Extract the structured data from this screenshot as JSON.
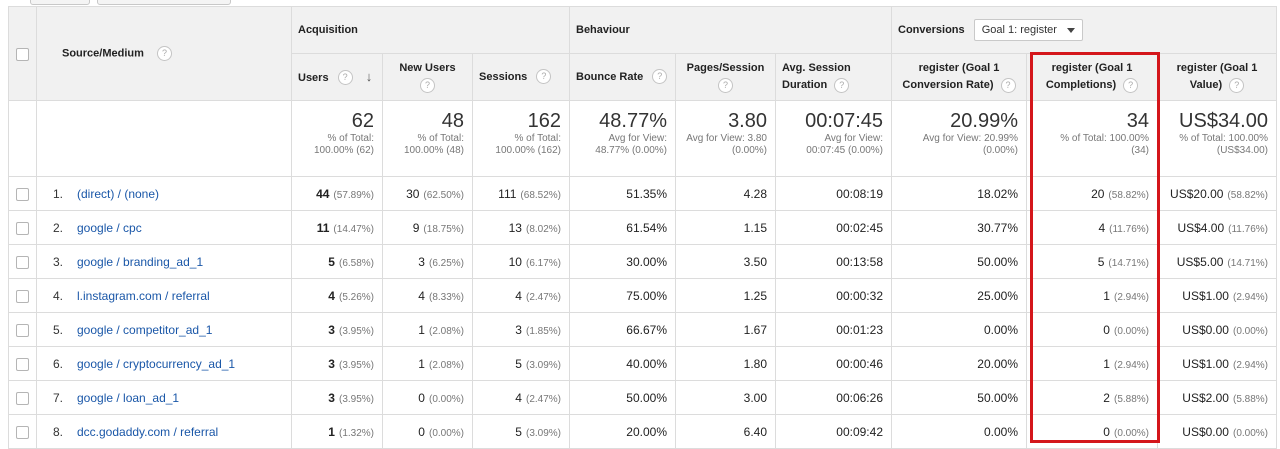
{
  "header": {
    "source_medium": "Source/Medium",
    "acquisition": "Acquisition",
    "behaviour": "Behaviour",
    "conversions": "Conversions",
    "goal_select": "Goal 1: register",
    "columns": {
      "users": "Users",
      "new_users": "New Users",
      "sessions": "Sessions",
      "bounce_rate": "Bounce Rate",
      "pages_session": "Pages/Session",
      "avg_session_l1": "Avg. Session",
      "avg_session_l2": "Duration",
      "conv_rate_l1": "register (Goal 1",
      "conv_rate_l2": "Conversion Rate)",
      "completions_l1": "register (Goal 1",
      "completions_l2": "Completions)",
      "value_l1": "register (Goal 1",
      "value_l2": "Value)"
    },
    "help_glyph": "?",
    "sort_glyph": "↓"
  },
  "totals": {
    "users": {
      "big": "62",
      "s1": "% of Total:",
      "s2": "100.00% (62)"
    },
    "new_users": {
      "big": "48",
      "s1": "% of Total:",
      "s2": "100.00% (48)"
    },
    "sessions": {
      "big": "162",
      "s1": "% of Total:",
      "s2": "100.00% (162)"
    },
    "bounce_rate": {
      "big": "48.77%",
      "s1": "Avg for View:",
      "s2": "48.77% (0.00%)"
    },
    "pages_session": {
      "big": "3.80",
      "s1": "Avg for View: 3.80",
      "s2": "(0.00%)"
    },
    "avg_session": {
      "big": "00:07:45",
      "s1": "Avg for View:",
      "s2": "00:07:45 (0.00%)"
    },
    "conv_rate": {
      "big": "20.99%",
      "s1": "Avg for View: 20.99%",
      "s2": "(0.00%)"
    },
    "completions": {
      "big": "34",
      "s1": "% of Total: 100.00%",
      "s2": "(34)"
    },
    "value": {
      "big": "US$34.00",
      "s1": "% of Total: 100.00%",
      "s2": "(US$34.00)"
    }
  },
  "rows": [
    {
      "n": "1.",
      "src": "(direct) / (none)",
      "users": "44",
      "users_p": "(57.89%)",
      "new": "30",
      "new_p": "(62.50%)",
      "sess": "111",
      "sess_p": "(68.52%)",
      "br": "51.35%",
      "ps": "4.28",
      "dur": "00:08:19",
      "cr": "18.02%",
      "comp": "20",
      "comp_p": "(58.82%)",
      "val": "US$20.00",
      "val_p": "(58.82%)"
    },
    {
      "n": "2.",
      "src": "google / cpc",
      "users": "11",
      "users_p": "(14.47%)",
      "new": "9",
      "new_p": "(18.75%)",
      "sess": "13",
      "sess_p": "(8.02%)",
      "br": "61.54%",
      "ps": "1.15",
      "dur": "00:02:45",
      "cr": "30.77%",
      "comp": "4",
      "comp_p": "(11.76%)",
      "val": "US$4.00",
      "val_p": "(11.76%)"
    },
    {
      "n": "3.",
      "src": "google / branding_ad_1",
      "users": "5",
      "users_p": "(6.58%)",
      "new": "3",
      "new_p": "(6.25%)",
      "sess": "10",
      "sess_p": "(6.17%)",
      "br": "30.00%",
      "ps": "3.50",
      "dur": "00:13:58",
      "cr": "50.00%",
      "comp": "5",
      "comp_p": "(14.71%)",
      "val": "US$5.00",
      "val_p": "(14.71%)"
    },
    {
      "n": "4.",
      "src": "l.instagram.com / referral",
      "users": "4",
      "users_p": "(5.26%)",
      "new": "4",
      "new_p": "(8.33%)",
      "sess": "4",
      "sess_p": "(2.47%)",
      "br": "75.00%",
      "ps": "1.25",
      "dur": "00:00:32",
      "cr": "25.00%",
      "comp": "1",
      "comp_p": "(2.94%)",
      "val": "US$1.00",
      "val_p": "(2.94%)"
    },
    {
      "n": "5.",
      "src": "google / competitor_ad_1",
      "users": "3",
      "users_p": "(3.95%)",
      "new": "1",
      "new_p": "(2.08%)",
      "sess": "3",
      "sess_p": "(1.85%)",
      "br": "66.67%",
      "ps": "1.67",
      "dur": "00:01:23",
      "cr": "0.00%",
      "comp": "0",
      "comp_p": "(0.00%)",
      "val": "US$0.00",
      "val_p": "(0.00%)"
    },
    {
      "n": "6.",
      "src": "google / cryptocurrency_ad_1",
      "users": "3",
      "users_p": "(3.95%)",
      "new": "1",
      "new_p": "(2.08%)",
      "sess": "5",
      "sess_p": "(3.09%)",
      "br": "40.00%",
      "ps": "1.80",
      "dur": "00:00:46",
      "cr": "20.00%",
      "comp": "1",
      "comp_p": "(2.94%)",
      "val": "US$1.00",
      "val_p": "(2.94%)"
    },
    {
      "n": "7.",
      "src": "google / loan_ad_1",
      "users": "3",
      "users_p": "(3.95%)",
      "new": "0",
      "new_p": "(0.00%)",
      "sess": "4",
      "sess_p": "(2.47%)",
      "br": "50.00%",
      "ps": "3.00",
      "dur": "00:06:26",
      "cr": "50.00%",
      "comp": "2",
      "comp_p": "(5.88%)",
      "val": "US$2.00",
      "val_p": "(5.88%)"
    },
    {
      "n": "8.",
      "src": "dcc.godaddy.com / referral",
      "users": "1",
      "users_p": "(1.32%)",
      "new": "0",
      "new_p": "(0.00%)",
      "sess": "5",
      "sess_p": "(3.09%)",
      "br": "20.00%",
      "ps": "6.40",
      "dur": "00:09:42",
      "cr": "0.00%",
      "comp": "0",
      "comp_p": "(0.00%)",
      "val": "US$0.00",
      "val_p": "(0.00%)"
    }
  ]
}
